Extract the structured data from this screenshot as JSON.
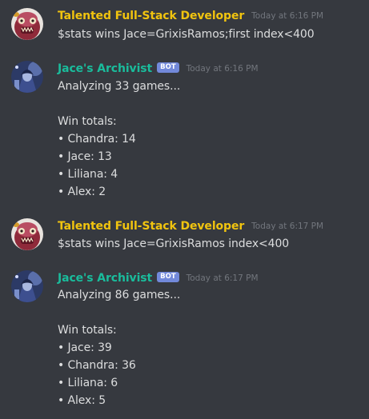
{
  "messages": [
    {
      "author": "Talented Full-Stack Developer",
      "timestamp": "Today at 6:16 PM",
      "lines": [
        "$stats wins Jace=GrixisRamos;first index<400"
      ]
    },
    {
      "author": "Jace's Archivist",
      "badge": "BOT",
      "timestamp": "Today at 6:16 PM",
      "intro": "Analyzing 33 games...",
      "totals_label": "Win totals:",
      "totals": [
        "• Chandra: 14",
        "• Jace: 13",
        "• Liliana: 4",
        "• Alex: 2"
      ]
    },
    {
      "author": "Talented Full-Stack Developer",
      "timestamp": "Today at 6:17 PM",
      "lines": [
        "$stats wins Jace=GrixisRamos index<400"
      ]
    },
    {
      "author": "Jace's Archivist",
      "badge": "BOT",
      "timestamp": "Today at 6:17 PM",
      "intro": "Analyzing 86 games...",
      "totals_label": "Win totals:",
      "totals": [
        "• Jace: 39",
        "• Chandra: 36",
        "• Liliana: 6",
        "• Alex: 5"
      ]
    }
  ],
  "colors": {
    "background": "#36393f",
    "developer_name": "#f1c40f",
    "bot_name": "#1abc9c",
    "bot_badge": "#7289da",
    "timestamp": "#72767d",
    "text": "#dcddde"
  },
  "avatars": {
    "developer": "red-creature-avatar",
    "bot": "blue-wizard-avatar"
  }
}
